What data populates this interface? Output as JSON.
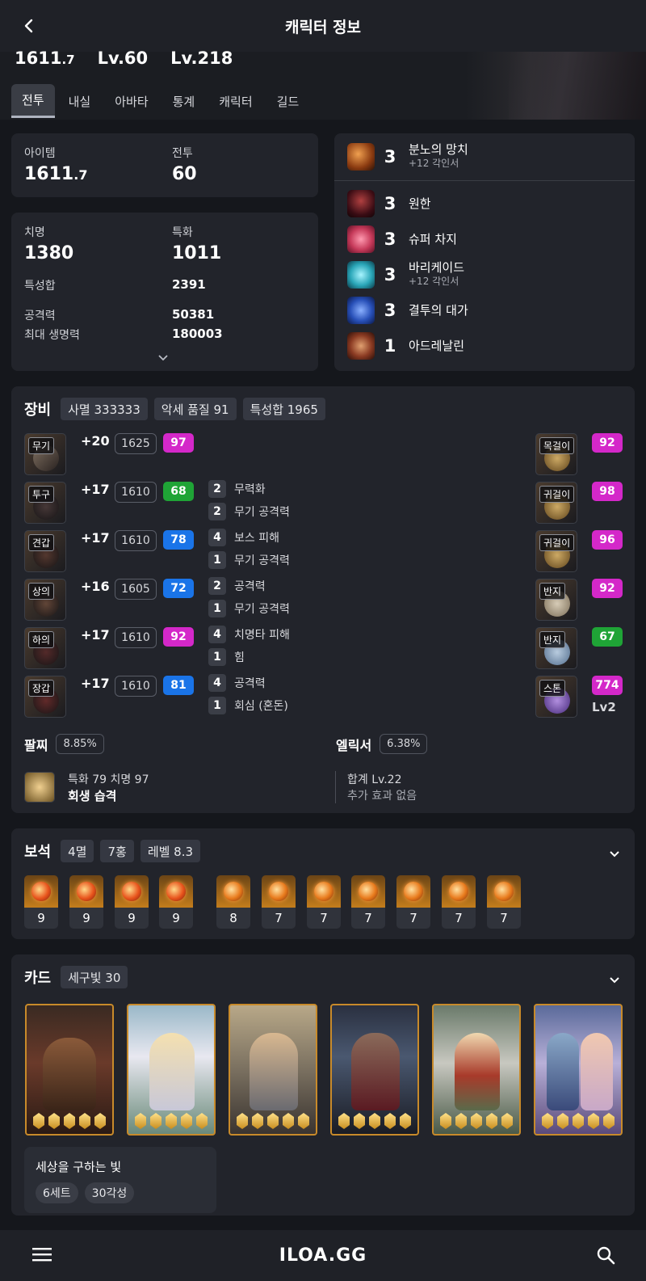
{
  "header": {
    "title": "캐릭터 정보"
  },
  "hero": {
    "item_level_int": "1611",
    "item_level_dec": ".7",
    "combat_level": "Lv.60",
    "expedition_level": "Lv.218"
  },
  "tabs": [
    "전투",
    "내실",
    "아바타",
    "통계",
    "캐릭터",
    "길드"
  ],
  "summary": {
    "item_label": "아이템",
    "item_int": "1611",
    "item_dec": ".7",
    "combat_label": "전투",
    "combat_value": "60"
  },
  "stats": {
    "crit_label": "치명",
    "crit_value": "1380",
    "spec_label": "특화",
    "spec_value": "1011",
    "total_label": "특성합",
    "total_value": "2391",
    "atk_label": "공격력",
    "atk_value": "50381",
    "hp_label": "최대 생명력",
    "hp_value": "180003"
  },
  "engravings": [
    {
      "level": "3",
      "name": "분노의 망치",
      "sub": "+12 각인서",
      "color": "#c8641e"
    },
    {
      "level": "3",
      "name": "원한",
      "sub": "",
      "color": "#7a1f2a"
    },
    {
      "level": "3",
      "name": "슈퍼 차지",
      "sub": "",
      "color": "#c63a5a"
    },
    {
      "level": "3",
      "name": "바리케이드",
      "sub": "+12 각인서",
      "color": "#2aa6b8"
    },
    {
      "level": "3",
      "name": "결투의 대가",
      "sub": "",
      "color": "#2850b8"
    },
    {
      "level": "1",
      "name": "아드레날린",
      "sub": "",
      "color": "#8a3a22"
    }
  ],
  "equipment": {
    "title": "장비",
    "chips": [
      "사멸 333333",
      "악세 품질 91",
      "특성합 1965"
    ],
    "items": [
      {
        "slot": "무기",
        "refine": "+20",
        "ilvl": "1625",
        "quality": "97",
        "qcolor": "pink",
        "engr": []
      },
      {
        "slot": "투구",
        "refine": "+17",
        "ilvl": "1610",
        "quality": "68",
        "qcolor": "green",
        "engr": [
          {
            "n": "2",
            "t": "무력화"
          },
          {
            "n": "2",
            "t": "무기 공격력"
          }
        ]
      },
      {
        "slot": "견갑",
        "refine": "+17",
        "ilvl": "1610",
        "quality": "78",
        "qcolor": "blue",
        "engr": [
          {
            "n": "4",
            "t": "보스 피해"
          },
          {
            "n": "1",
            "t": "무기 공격력"
          }
        ]
      },
      {
        "slot": "상의",
        "refine": "+16",
        "ilvl": "1605",
        "quality": "72",
        "qcolor": "blue",
        "engr": [
          {
            "n": "2",
            "t": "공격력"
          },
          {
            "n": "1",
            "t": "무기 공격력"
          }
        ]
      },
      {
        "slot": "하의",
        "refine": "+17",
        "ilvl": "1610",
        "quality": "92",
        "qcolor": "pink",
        "engr": [
          {
            "n": "4",
            "t": "치명타 피해"
          },
          {
            "n": "1",
            "t": "힘"
          }
        ]
      },
      {
        "slot": "장갑",
        "refine": "+17",
        "ilvl": "1610",
        "quality": "81",
        "qcolor": "blue",
        "engr": [
          {
            "n": "4",
            "t": "공격력"
          },
          {
            "n": "1",
            "t": "회심 (혼돈)"
          }
        ]
      }
    ],
    "accessories": [
      {
        "slot": "목걸이",
        "quality": "92",
        "qcolor": "pink"
      },
      {
        "slot": "귀걸이",
        "quality": "98",
        "qcolor": "pink"
      },
      {
        "slot": "귀걸이",
        "quality": "96",
        "qcolor": "pink"
      },
      {
        "slot": "반지",
        "quality": "92",
        "qcolor": "pink"
      },
      {
        "slot": "반지",
        "quality": "67",
        "qcolor": "green"
      },
      {
        "slot": "스톤",
        "quality": "774",
        "qcolor": "pink",
        "extra": "Lv2"
      }
    ],
    "bracelet": {
      "title": "팔찌",
      "pct": "8.85%",
      "line1": "특화 79  치명 97",
      "line2": "회생  습격"
    },
    "elixir": {
      "title": "엘릭서",
      "pct": "6.38%",
      "line1": "합계 Lv.22",
      "line2": "추가 효과 없음"
    }
  },
  "gems": {
    "title": "보석",
    "chips": [
      "4멸",
      "7홍",
      "레벨 8.3"
    ],
    "levels": [
      "9",
      "9",
      "9",
      "9",
      "8",
      "7",
      "7",
      "7",
      "7",
      "7",
      "7"
    ]
  },
  "cards": {
    "title": "카드",
    "chip": "세구빛 30",
    "set_name": "세상을 구하는 빛",
    "set_chips": [
      "6세트",
      "30각성"
    ]
  },
  "footer": {
    "logo": "ILOA.GG"
  }
}
